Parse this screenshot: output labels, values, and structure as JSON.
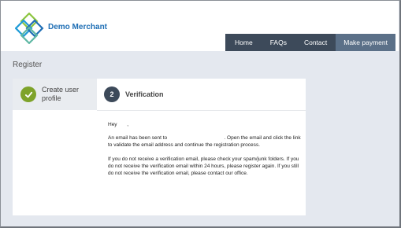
{
  "brand": {
    "name": "Demo Merchant"
  },
  "nav": {
    "items": [
      "Home",
      "FAQs",
      "Contact"
    ],
    "cta": "Make payment"
  },
  "page": {
    "title": "Register"
  },
  "steps": [
    {
      "label": "Create user profile",
      "status": "complete"
    },
    {
      "number": "2",
      "label": "Verification",
      "status": "active"
    }
  ],
  "message": {
    "greeting": "Hey",
    "greeting_end": ",",
    "line1_start": "An email has been sent to",
    "line1_end": ". Open the email and click the link to validate the email address and continue the registration process.",
    "para2": "If you do not receive a verification email, please check your spam/junk folders. If you do not receive the verification email within 24 hours, please register again. If you still do not receive the verification email, please contact our office."
  },
  "colors": {
    "nav_bg": "#3d4a5a",
    "cta_bg": "#5b7088",
    "step_complete": "#7ea32a",
    "brand": "#1f6fb5",
    "page_bg": "#e4e8ef"
  }
}
